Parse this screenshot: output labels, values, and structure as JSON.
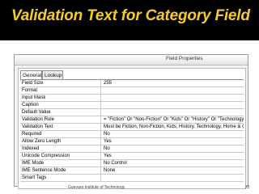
{
  "slide": {
    "title": "Validation Text for Category Field",
    "footer": "Guevara Institute of Technology",
    "page_number": "22"
  },
  "panel": {
    "title": "Field Properties",
    "tabs": [
      "General",
      "Lookup"
    ],
    "active_tab": "General",
    "properties": [
      {
        "label": "Field Size",
        "value": "255"
      },
      {
        "label": "Format",
        "value": ""
      },
      {
        "label": "Input Mask",
        "value": ""
      },
      {
        "label": "Caption",
        "value": ""
      },
      {
        "label": "Default Value",
        "value": ""
      },
      {
        "label": "Validation Rule",
        "value": "= \"Fiction\" Or \"Non-Fiction\" Or \"Kids\" Or \"History\" Or \"Technology\" Or \"H"
      },
      {
        "label": "Validation Text",
        "value": "Must be Fiction, Non-Fiction, Kids, History, Technology, Home & Gard"
      },
      {
        "label": "Required",
        "value": "No"
      },
      {
        "label": "Allow Zero Length",
        "value": "Yes"
      },
      {
        "label": "Indexed",
        "value": "No"
      },
      {
        "label": "Unicode Compression",
        "value": "Yes"
      },
      {
        "label": "IME Mode",
        "value": "No Control"
      },
      {
        "label": "IME Sentence Mode",
        "value": "None"
      },
      {
        "label": "Smart Tags",
        "value": ""
      }
    ]
  }
}
